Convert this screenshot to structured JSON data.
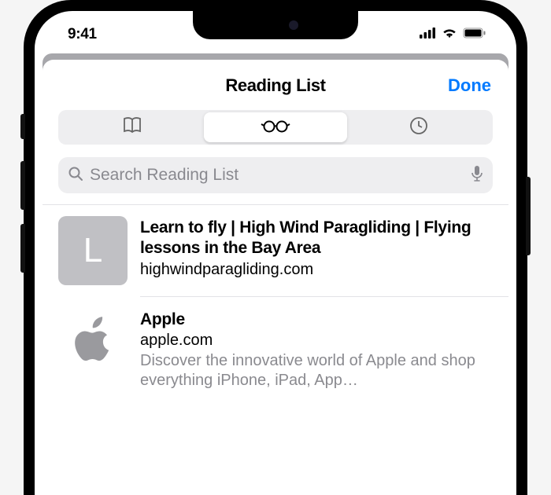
{
  "status": {
    "time": "9:41"
  },
  "sheet": {
    "title": "Reading List",
    "done": "Done"
  },
  "tabs": {
    "bookmarks": "bookmarks-icon",
    "reading_list": "reading-list-icon",
    "history": "history-icon"
  },
  "search": {
    "placeholder": "Search Reading List"
  },
  "items": [
    {
      "thumb_letter": "L",
      "title": "Learn to fly | High Wind Paragliding | Flying lessons in the Bay Area",
      "domain": "highwindparagliding.com",
      "desc": ""
    },
    {
      "thumb_icon": "apple-logo",
      "title": "Apple",
      "domain": "apple.com",
      "desc": "Discover the innovative world of Apple and shop everything iPhone, iPad, App…"
    }
  ]
}
